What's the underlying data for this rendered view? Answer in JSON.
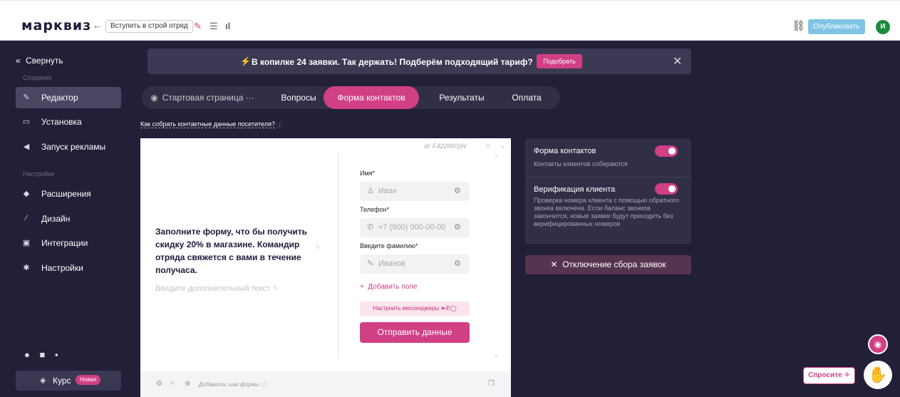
{
  "topbar": {
    "logo": "марквиз",
    "quiz_name": "Вступить в строй отряд",
    "publish_label": "Опубликовать",
    "avatar_letter": "И"
  },
  "sidebar": {
    "collapse_label": "Свернуть",
    "section_create": "Создание",
    "section_settings": "Настройки",
    "items": [
      {
        "label": "Редактор",
        "icon": "pencil-icon",
        "active": true
      },
      {
        "label": "Установка",
        "icon": "install-icon"
      },
      {
        "label": "Запуск рекламы",
        "icon": "megaphone-icon"
      },
      {
        "label": "Расширения",
        "icon": "puzzle-icon"
      },
      {
        "label": "Дизайн",
        "icon": "brush-icon"
      },
      {
        "label": "Интеграции",
        "icon": "integrations-icon"
      },
      {
        "label": "Настройки",
        "icon": "gear-icon"
      }
    ],
    "course_label": "Курс",
    "course_badge": "Новая"
  },
  "banner": {
    "text": "В копилке 24 заявки. Так держать! Подберём подходящий тариф?",
    "button_label": "Подобрать"
  },
  "tabs": [
    {
      "label": "Стартовая страница ···",
      "hidden": true
    },
    {
      "label": "Вопросы"
    },
    {
      "label": "Форма контактов",
      "active": true
    },
    {
      "label": "Результаты"
    },
    {
      "label": "Оплата"
    }
  ],
  "howto_link": "Как собрать контактные данные посетителя?",
  "preview": {
    "form_id": "id: F422f4lOjW",
    "heading": "Заполните форму, что бы получить скидку 20% в магазине. Командир отряда свяжется с вами в течение получаса.",
    "extra_text_placeholder": "Введите дополнительный текст",
    "fields": [
      {
        "label": "Имя*",
        "placeholder": "Иван",
        "icon": "user-icon"
      },
      {
        "label": "Телефон*",
        "placeholder": "+7 (900) 000-00-00",
        "icon": "phone-icon"
      },
      {
        "label": "Введите фамилию*",
        "placeholder": "Иванов",
        "icon": "pencil-icon"
      }
    ],
    "add_field_label": "Добавить поле",
    "messengers_label": "Настроить мессенджеры",
    "submit_label": "Отправить данные",
    "add_step_label": "Добавить шаг формы"
  },
  "settings": {
    "contact_form_title": "Форма контактов",
    "contact_form_desc": "Контакты клиентов собираются",
    "verification_title": "Верификация клиента",
    "verification_desc": "Проверка номера клиента с помощью обратного звонка включена. Если баланс звонков закончится, новые заявки будут приходить без верифицированных номеров"
  },
  "disable_label": "Отключение сбора заявок",
  "ask_label": "Спросите"
}
